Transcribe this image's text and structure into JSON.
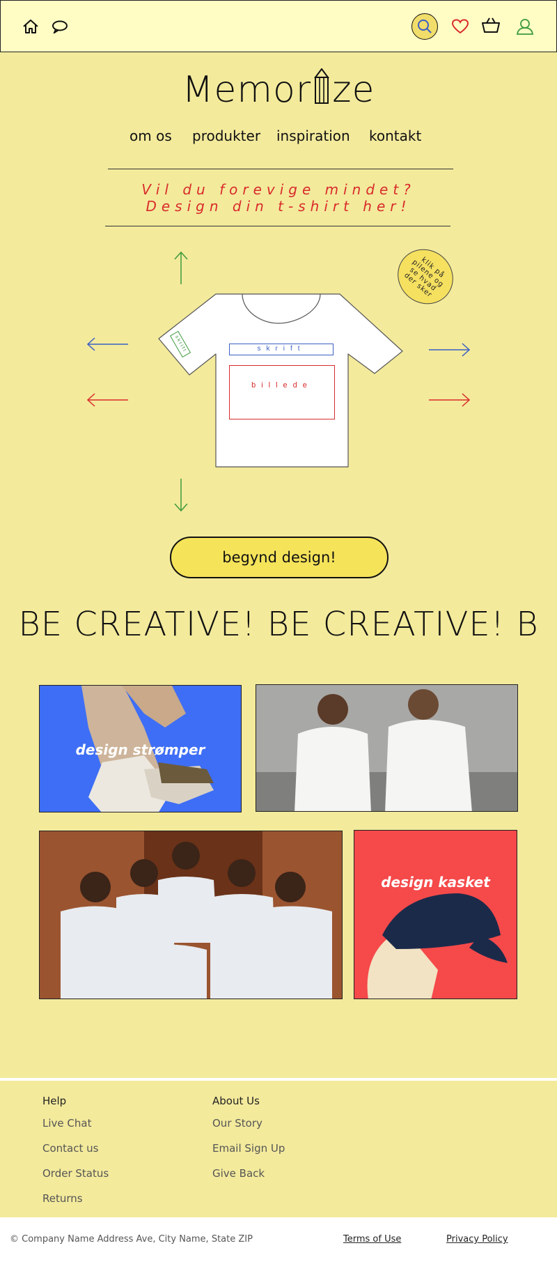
{
  "brand": {
    "logo_start": "Memor",
    "logo_end": "ze"
  },
  "nav": {
    "about": "om os",
    "products": "produkter",
    "inspiration": "inspiration",
    "contact": "kontakt"
  },
  "icons": {
    "home": "home-icon",
    "chat": "chat-icon",
    "search": "search-icon",
    "wishlist": "heart-icon",
    "basket": "basket-icon",
    "account": "user-icon"
  },
  "colors": {
    "page_bg": "#f3ea9c",
    "topbar_bg": "#fffcc4",
    "accent_red": "#d92b2b",
    "accent_blue": "#3b5fc4",
    "accent_green": "#3c9a3c",
    "button_bg": "#f5e35a"
  },
  "tagline": {
    "line1": "Vil du forevige mindet?",
    "line2": "Design din t-shirt her!"
  },
  "designer": {
    "hint": "klik på pilene og se hvad der sker",
    "text_area": "skrift",
    "image_area": "billede",
    "sleeve_label": "skrift"
  },
  "cta": {
    "label": "begynd design!"
  },
  "marquee": {
    "text": "BE CREATIVE! BE CREATIVE! B"
  },
  "tiles": {
    "socks": {
      "caption": "design strømper",
      "image": "legs-with-socks-and-sneakers"
    },
    "tshirts_pair": {
      "image": "two-people-white-tshirts"
    },
    "group": {
      "image": "group-white-tshirts"
    },
    "cap": {
      "caption": "design kasket",
      "image": "person-wearing-navy-cap"
    }
  },
  "footer": {
    "help": {
      "title": "Help",
      "links": [
        "Live Chat",
        "Contact us",
        "Order Status",
        "Returns"
      ]
    },
    "about": {
      "title": "About Us",
      "links": [
        "Our Story",
        "Email Sign Up",
        "Give Back"
      ]
    },
    "copyright": "© Company Name Address Ave, City Name, State ZIP",
    "terms": "Terms of Use",
    "privacy": "Privacy Policy"
  }
}
